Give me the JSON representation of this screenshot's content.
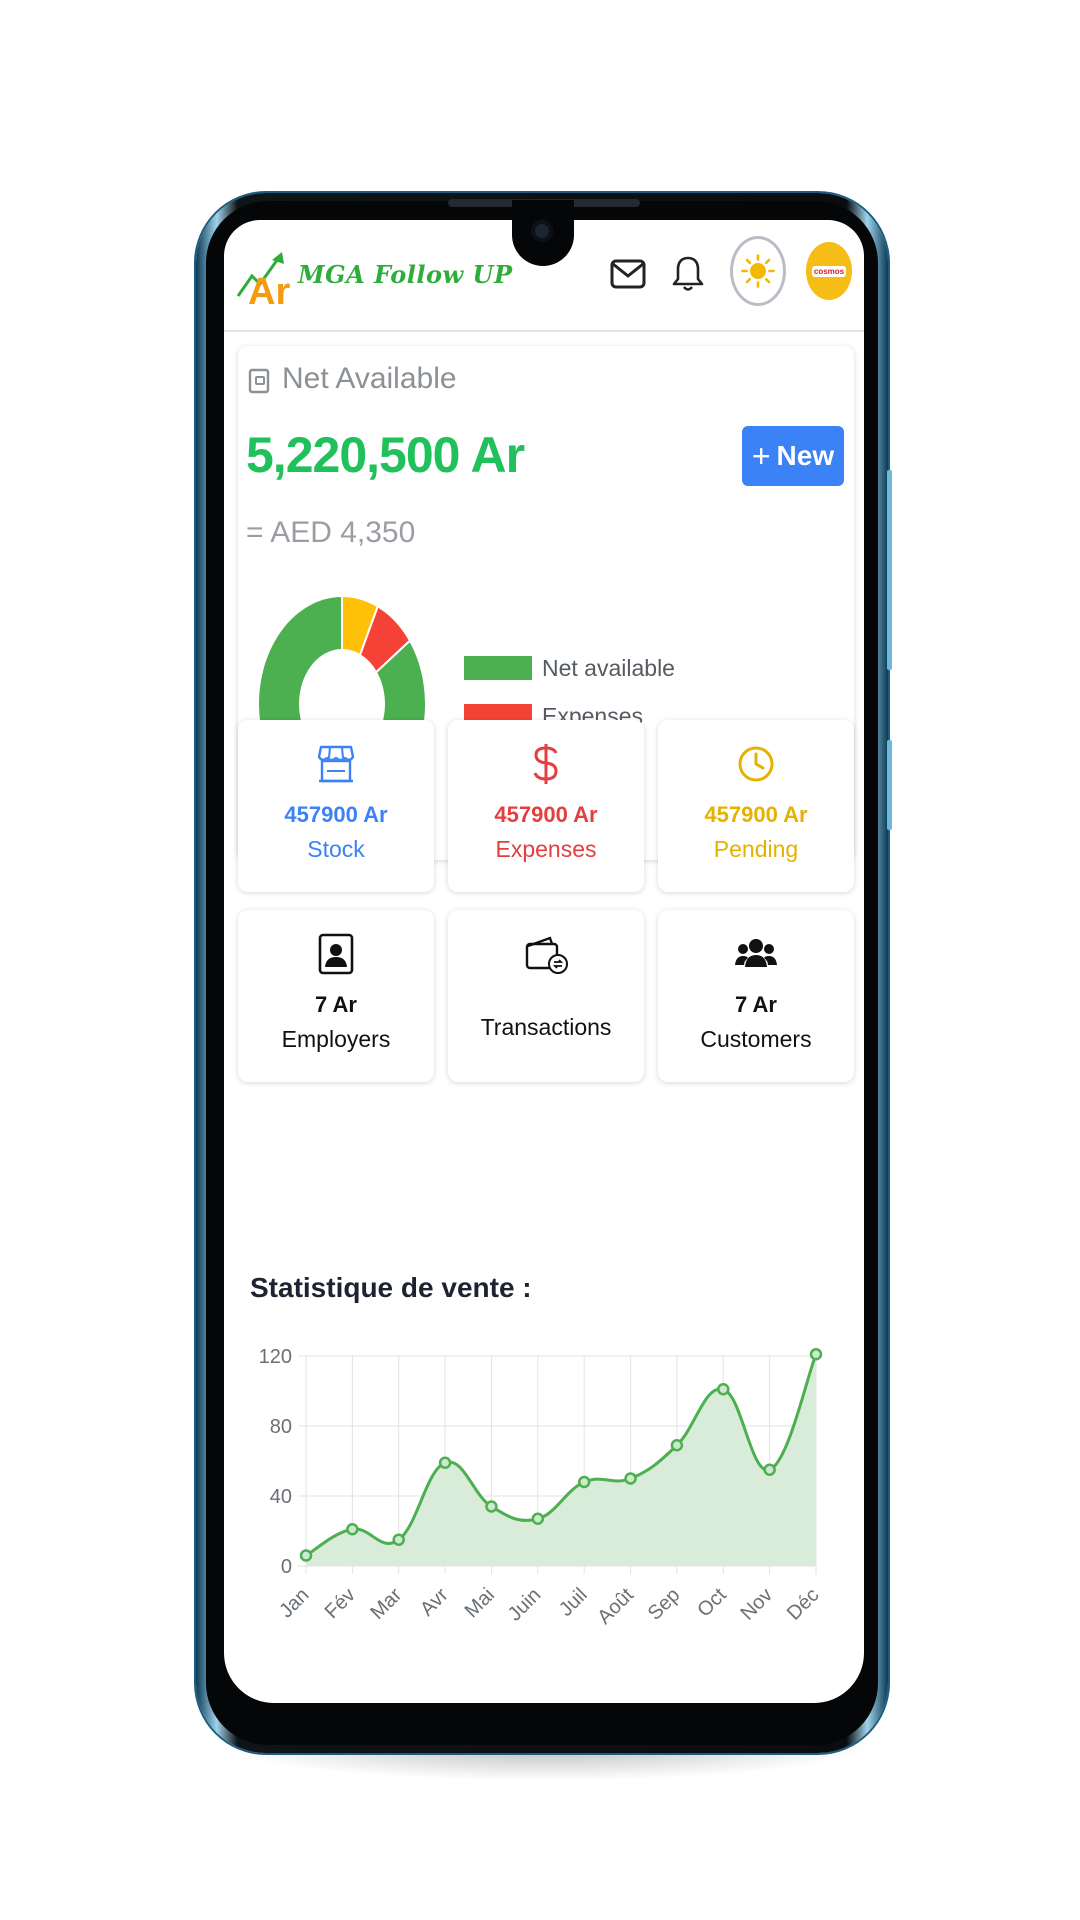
{
  "header": {
    "logo_symbol": "Ar",
    "logo_text": "MGA Follow UP",
    "avatar_text": "cosmos",
    "icons": [
      "mail-icon",
      "bell-icon",
      "sun-icon"
    ]
  },
  "net": {
    "title": "Net Available",
    "amount": "5,220,500 Ar",
    "converted": "= AED 4,350",
    "new_button": "New",
    "donut": [
      {
        "label": "Net available",
        "value": 85,
        "color": "#4caf50"
      },
      {
        "label": "Expenses",
        "value": 8,
        "color": "#f44336"
      },
      {
        "label": "Pending",
        "value": 7,
        "color": "#ffc107"
      }
    ]
  },
  "tiles": [
    {
      "value": "457900 Ar",
      "label": "Stock",
      "icon": "store-icon",
      "color": "#3b82f6"
    },
    {
      "value": "457900 Ar",
      "label": "Expenses",
      "icon": "dollar-icon",
      "color": "#e53e3e"
    },
    {
      "value": "457900 Ar",
      "label": "Pending",
      "icon": "clock-icon",
      "color": "#e5b200"
    },
    {
      "value": "7 Ar",
      "label": "Employers",
      "icon": "employee-badge-icon",
      "color": "#111111"
    },
    {
      "value": "",
      "label": "Transactions",
      "icon": "wallet-transfer-icon",
      "color": "#111111"
    },
    {
      "value": "7 Ar",
      "label": "Customers",
      "icon": "users-icon",
      "color": "#111111"
    }
  ],
  "stats": {
    "title": "Statistique de vente :"
  },
  "chart_data": {
    "type": "area",
    "categories": [
      "Jan",
      "Fév",
      "Mar",
      "Avr",
      "Mai",
      "Juin",
      "Juil",
      "Août",
      "Sep",
      "Oct",
      "Nov",
      "Déc"
    ],
    "values": [
      6,
      21,
      15,
      59,
      34,
      27,
      48,
      50,
      69,
      101,
      55,
      121
    ],
    "y_ticks": [
      0,
      40,
      80,
      120
    ],
    "ylim": [
      0,
      120
    ],
    "grid": true,
    "line_color": "#4caf50",
    "fill_color": "#d9ecd9"
  }
}
